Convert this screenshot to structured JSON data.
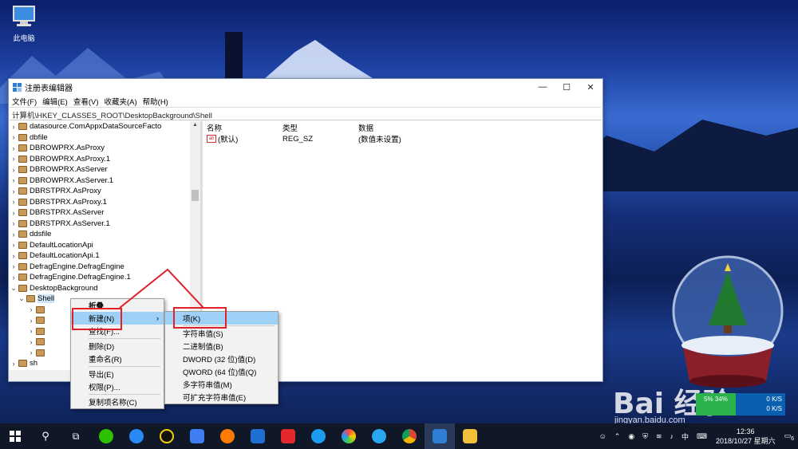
{
  "desktop": {
    "icon_label": "此电脑"
  },
  "window": {
    "title": "注册表编辑器",
    "menu": [
      "文件(F)",
      "编辑(E)",
      "查看(V)",
      "收藏夹(A)",
      "帮助(H)"
    ],
    "address": "计算机\\HKEY_CLASSES_ROOT\\DesktopBackground\\Shell"
  },
  "tree": [
    {
      "label": "datasource.ComAppxDataSourceFacto",
      "expand": "›"
    },
    {
      "label": "dbfile",
      "expand": "›"
    },
    {
      "label": "DBROWPRX.AsProxy",
      "expand": "›"
    },
    {
      "label": "DBROWPRX.AsProxy.1",
      "expand": "›"
    },
    {
      "label": "DBROWPRX.AsServer",
      "expand": "›"
    },
    {
      "label": "DBROWPRX.AsServer.1",
      "expand": "›"
    },
    {
      "label": "DBRSTPRX.AsProxy",
      "expand": "›"
    },
    {
      "label": "DBRSTPRX.AsProxy.1",
      "expand": "›"
    },
    {
      "label": "DBRSTPRX.AsServer",
      "expand": "›"
    },
    {
      "label": "DBRSTPRX.AsServer.1",
      "expand": "›"
    },
    {
      "label": "ddsfile",
      "expand": "›"
    },
    {
      "label": "DefaultLocationApi",
      "expand": "›"
    },
    {
      "label": "DefaultLocationApi.1",
      "expand": "›"
    },
    {
      "label": "DefragEngine.DefragEngine",
      "expand": "›"
    },
    {
      "label": "DefragEngine.DefragEngine.1",
      "expand": "›"
    },
    {
      "label": "DesktopBackground",
      "expand": "⌄"
    }
  ],
  "tree_selected": "Shell",
  "tree_partial": "sh",
  "values": {
    "headers": [
      "名称",
      "类型",
      "数据"
    ],
    "rows": [
      {
        "name": "(默认)",
        "type": "REG_SZ",
        "data": "(数值未设置)"
      }
    ]
  },
  "context_menu": {
    "items": [
      "折叠",
      "新建(N)",
      "查找(F)...",
      "删除(D)",
      "重命名(R)",
      "导出(E)",
      "权限(P)...",
      "复制项名称(C)"
    ]
  },
  "submenu": {
    "items": [
      "项(K)",
      "字符串值(S)",
      "二进制值(B)",
      "DWORD (32 位)值(D)",
      "QWORD (64 位)值(Q)",
      "多字符串值(M)",
      "可扩充字符串值(E)"
    ]
  },
  "watermark": {
    "brand": "Bai 经验",
    "site": "jingyan.baidu.com"
  },
  "net_widget": {
    "pct_top": "",
    "pct_bottom": "5% 34%",
    "up": "0 K/S",
    "down": "0 K/S"
  },
  "taskbar": {
    "time": "12:36",
    "date": "2018/10/27 星期六",
    "ime": "中",
    "notify_count": "6"
  },
  "colors": {
    "highlight": "#9fd0f5",
    "annotation_red": "#e0202a",
    "taskbar": "#101828"
  }
}
